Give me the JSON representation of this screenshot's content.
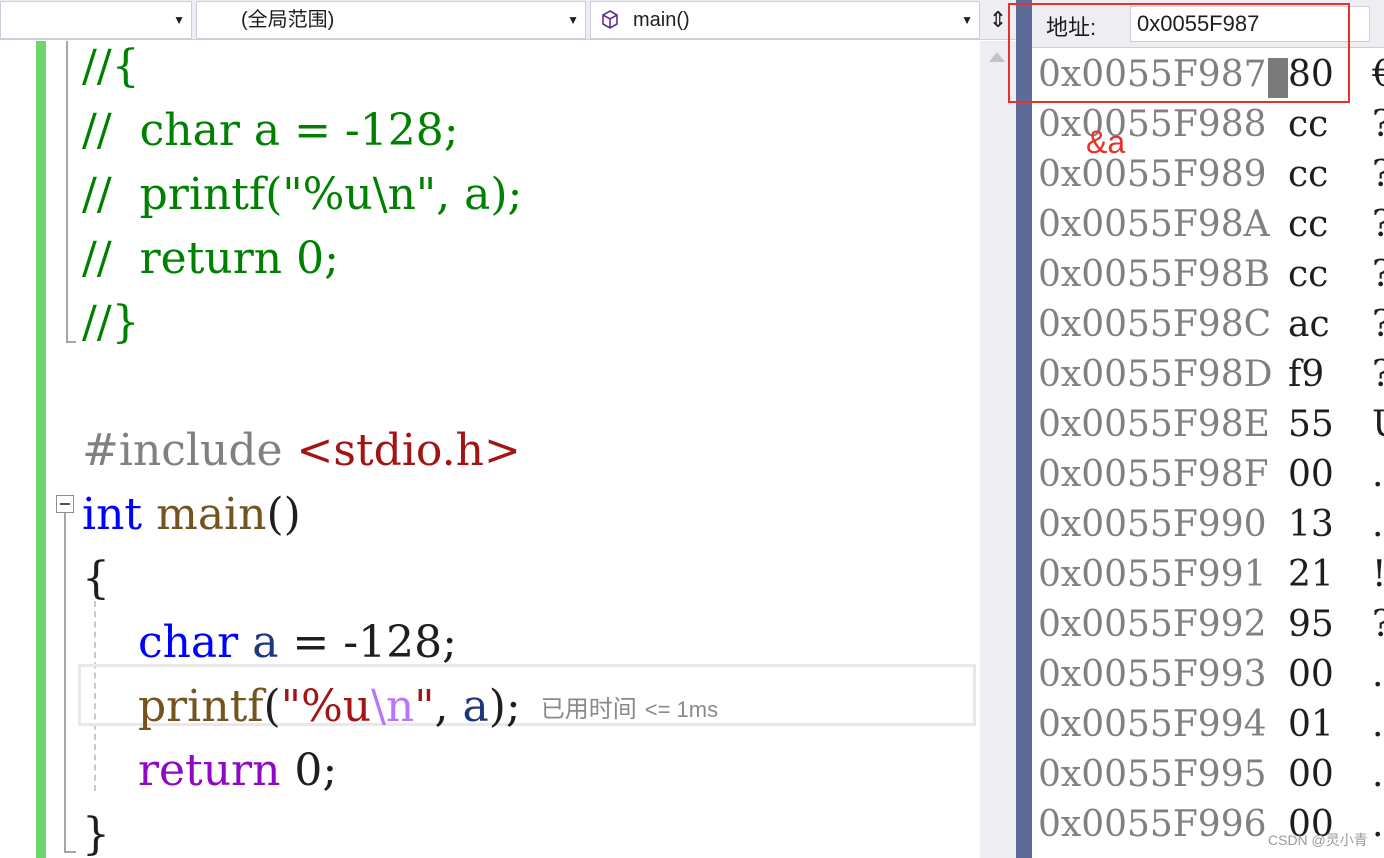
{
  "navbar": {
    "project_combo": "",
    "scope_combo": "(全局范围)",
    "member_combo": "main()",
    "split_glyph": "⇕"
  },
  "editor": {
    "lines": [
      {
        "tokens": [
          {
            "t": "//{",
            "c": "comment"
          }
        ]
      },
      {
        "tokens": [
          {
            "t": "//  char a = -128;",
            "c": "comment"
          }
        ]
      },
      {
        "tokens": [
          {
            "t": "//  printf(\"%u\\n\", a);",
            "c": "comment"
          }
        ]
      },
      {
        "tokens": [
          {
            "t": "//  return 0;",
            "c": "comment"
          }
        ]
      },
      {
        "tokens": [
          {
            "t": "//}",
            "c": "comment"
          }
        ]
      },
      {
        "tokens": []
      },
      {
        "tokens": [
          {
            "t": "#include ",
            "c": "pre"
          },
          {
            "t": "<stdio.h>",
            "c": "str"
          }
        ]
      },
      {
        "tokens": [
          {
            "t": "int",
            "c": "kw"
          },
          {
            "t": " ",
            "c": "num"
          },
          {
            "t": "main",
            "c": "func"
          },
          {
            "t": "()",
            "c": "num"
          }
        ]
      },
      {
        "tokens": [
          {
            "t": "{",
            "c": "num"
          }
        ]
      },
      {
        "tokens": [
          {
            "t": "    ",
            "c": "num"
          },
          {
            "t": "char",
            "c": "kw"
          },
          {
            "t": " ",
            "c": "num"
          },
          {
            "t": "a",
            "c": "var"
          },
          {
            "t": " = -128;",
            "c": "num"
          }
        ]
      },
      {
        "tokens": [
          {
            "t": "    ",
            "c": "num"
          },
          {
            "t": "printf",
            "c": "func"
          },
          {
            "t": "(",
            "c": "num"
          },
          {
            "t": "\"%u",
            "c": "str"
          },
          {
            "t": "\\n",
            "c": "esc"
          },
          {
            "t": "\"",
            "c": "str"
          },
          {
            "t": ", ",
            "c": "num"
          },
          {
            "t": "a",
            "c": "var"
          },
          {
            "t": ");",
            "c": "num"
          }
        ],
        "hint": "已用时间",
        "hint_suffix": "<= 1ms"
      },
      {
        "tokens": [
          {
            "t": "    ",
            "c": "num"
          },
          {
            "t": "return",
            "c": "ctrl"
          },
          {
            "t": " 0;",
            "c": "num"
          }
        ]
      },
      {
        "tokens": [
          {
            "t": "}",
            "c": "num"
          }
        ]
      }
    ]
  },
  "memory": {
    "address_label": "地址:",
    "address_value": "0x0055F987",
    "rows": [
      {
        "addr": "0x0055F987",
        "val": "80",
        "chr": "€"
      },
      {
        "addr": "0x0055F988",
        "val": "cc",
        "chr": "?"
      },
      {
        "addr": "0x0055F989",
        "val": "cc",
        "chr": "?"
      },
      {
        "addr": "0x0055F98A",
        "val": "cc",
        "chr": "?"
      },
      {
        "addr": "0x0055F98B",
        "val": "cc",
        "chr": "?"
      },
      {
        "addr": "0x0055F98C",
        "val": "ac",
        "chr": "?"
      },
      {
        "addr": "0x0055F98D",
        "val": "f9",
        "chr": "?"
      },
      {
        "addr": "0x0055F98E",
        "val": "55",
        "chr": "U"
      },
      {
        "addr": "0x0055F98F",
        "val": "00",
        "chr": "."
      },
      {
        "addr": "0x0055F990",
        "val": "13",
        "chr": "."
      },
      {
        "addr": "0x0055F991",
        "val": "21",
        "chr": "!"
      },
      {
        "addr": "0x0055F992",
        "val": "95",
        "chr": "?"
      },
      {
        "addr": "0x0055F993",
        "val": "00",
        "chr": "."
      },
      {
        "addr": "0x0055F994",
        "val": "01",
        "chr": "."
      },
      {
        "addr": "0x0055F995",
        "val": "00",
        "chr": "."
      },
      {
        "addr": "0x0055F996",
        "val": "00",
        "chr": "."
      }
    ]
  },
  "annotation": {
    "label": "&a",
    "color": "#e8302a"
  },
  "watermark": "CSDN @灵小青"
}
